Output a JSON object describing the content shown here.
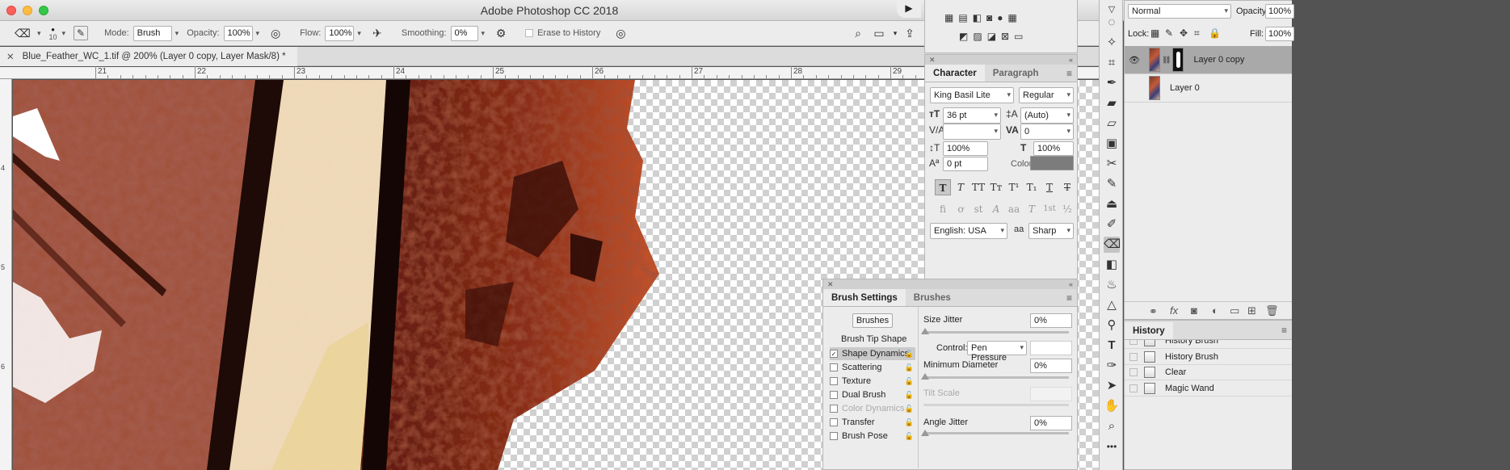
{
  "window": {
    "title": "Adobe Photoshop CC 2018"
  },
  "options": {
    "brush_size": "10",
    "mode_label": "Mode:",
    "mode_value": "Brush",
    "opacity_label": "Opacity:",
    "opacity_value": "100%",
    "flow_label": "Flow:",
    "flow_value": "100%",
    "smoothing_label": "Smoothing:",
    "smoothing_value": "0%",
    "erase_to_history": "Erase to History"
  },
  "document": {
    "tab_title": "Blue_Feather_WC_1.tif @ 200% (Layer 0 copy, Layer Mask/8) *"
  },
  "ruler": {
    "h_labels": [
      "21",
      "22",
      "23",
      "24",
      "25",
      "26",
      "27",
      "28",
      "29"
    ],
    "v_labels": [
      "4",
      "5",
      "6"
    ]
  },
  "character": {
    "tabs": [
      "Character",
      "Paragraph"
    ],
    "font_family": "King Basil Lite",
    "font_style": "Regular",
    "size": "36 pt",
    "leading": "(Auto)",
    "kerning": "",
    "tracking": "0",
    "vscale": "100%",
    "hscale": "100%",
    "baseline": "0 pt",
    "color_label": "Color:",
    "color": "#7c7c7c",
    "language": "English: USA",
    "aa_icon": "aa",
    "antialias": "Sharp"
  },
  "brush_settings": {
    "tabs": [
      "Brush Settings",
      "Brushes"
    ],
    "brushes_button": "Brushes",
    "tip_shape": "Brush Tip Shape",
    "items": [
      {
        "label": "Shape Dynamics",
        "checked": true,
        "active": true,
        "disabled": false
      },
      {
        "label": "Scattering",
        "checked": false,
        "active": false,
        "disabled": false
      },
      {
        "label": "Texture",
        "checked": false,
        "active": false,
        "disabled": false
      },
      {
        "label": "Dual Brush",
        "checked": false,
        "active": false,
        "disabled": false
      },
      {
        "label": "Color Dynamics",
        "checked": false,
        "active": false,
        "disabled": true
      },
      {
        "label": "Transfer",
        "checked": false,
        "active": false,
        "disabled": false
      },
      {
        "label": "Brush Pose",
        "checked": false,
        "active": false,
        "disabled": false
      }
    ],
    "size_jitter_label": "Size Jitter",
    "size_jitter": "0%",
    "control_label": "Control:",
    "control_value": "Pen Pressure",
    "min_diameter_label": "Minimum Diameter",
    "min_diameter": "0%",
    "tilt_scale_label": "Tilt Scale",
    "angle_jitter_label": "Angle Jitter",
    "angle_jitter": "0%"
  },
  "layers": {
    "blend_mode": "Normal",
    "opacity_label": "Opacity:",
    "opacity": "100%",
    "lock_label": "Lock:",
    "fill_label": "Fill:",
    "fill": "100%",
    "items": [
      {
        "name": "Layer 0 copy",
        "visible": true,
        "selected": true,
        "has_mask": true
      },
      {
        "name": "Layer 0",
        "visible": false,
        "selected": false,
        "has_mask": false
      }
    ]
  },
  "history": {
    "title": "History",
    "items": [
      "History Brush",
      "History Brush",
      "Clear",
      "Magic Wand"
    ]
  },
  "colors": {
    "selected_row": "#a9a9a9",
    "panel": "#ececec",
    "active_list": "#cacaca"
  }
}
